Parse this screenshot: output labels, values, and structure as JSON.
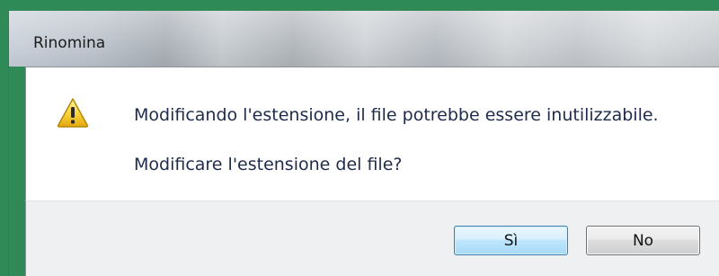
{
  "dialog": {
    "title": "Rinomina",
    "icon": "warning-icon",
    "message": "Modificando l'estensione, il file potrebbe essere inutilizzabile.",
    "question": "Modificare l'estensione del file?",
    "buttons": {
      "yes_label": "Sì",
      "no_label": "No"
    }
  },
  "colors": {
    "background_border": "#2e8b57",
    "text": "#1e2b4a",
    "footer": "#eff0f2",
    "yes_button_accent": "#3c7fb1"
  }
}
